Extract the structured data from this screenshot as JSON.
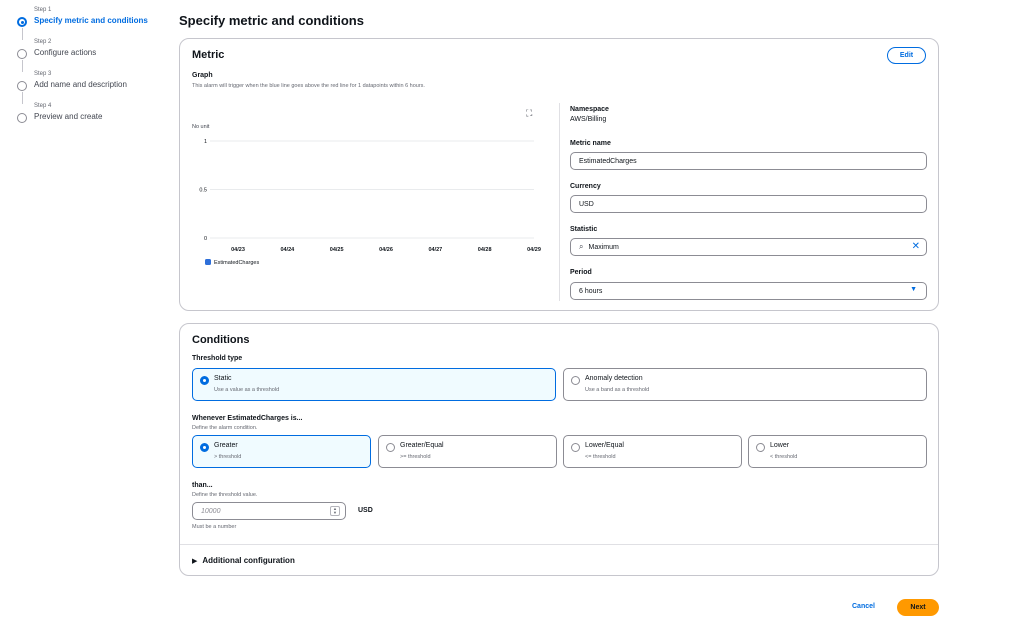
{
  "steps": [
    {
      "step": "Step 1",
      "label": "Specify metric and conditions",
      "active": true
    },
    {
      "step": "Step 2",
      "label": "Configure actions",
      "active": false
    },
    {
      "step": "Step 3",
      "label": "Add name and description",
      "active": false
    },
    {
      "step": "Step 4",
      "label": "Preview and create",
      "active": false
    }
  ],
  "page_title": "Specify metric and conditions",
  "metric": {
    "title": "Metric",
    "edit_label": "Edit",
    "graph_label": "Graph",
    "graph_hint": "This alarm will trigger when the blue line goes above the red line for 1 datapoints within 6 hours.",
    "expand_icon": "expand-icon",
    "namespace_label": "Namespace",
    "namespace_value": "AWS/Billing",
    "metric_name_label": "Metric name",
    "metric_name_value": "EstimatedCharges",
    "currency_label": "Currency",
    "currency_value": "USD",
    "statistic_label": "Statistic",
    "statistic_value": "Maximum",
    "period_label": "Period",
    "period_value": "6 hours"
  },
  "chart_data": {
    "type": "line",
    "ylabel": "No unit",
    "ylim": [
      0,
      1
    ],
    "yticks": [
      "1",
      "0.5",
      "0"
    ],
    "categories": [
      "04/23",
      "04/24",
      "04/25",
      "04/26",
      "04/27",
      "04/28",
      "04/29"
    ],
    "series": [
      {
        "name": "EstimatedCharges",
        "color": "#2e6fd9",
        "values": []
      }
    ]
  },
  "conditions": {
    "title": "Conditions",
    "threshold_type_label": "Threshold type",
    "threshold_types": [
      {
        "title": "Static",
        "sub": "Use a value as a threshold",
        "selected": true
      },
      {
        "title": "Anomaly detection",
        "sub": "Use a band as a threshold",
        "selected": false
      }
    ],
    "whenever_label": "Whenever EstimatedCharges is...",
    "whenever_hint": "Define the alarm condition.",
    "operators": [
      {
        "title": "Greater",
        "sub": "> threshold",
        "selected": true
      },
      {
        "title": "Greater/Equal",
        "sub": ">= threshold",
        "selected": false
      },
      {
        "title": "Lower/Equal",
        "sub": "<= threshold",
        "selected": false
      },
      {
        "title": "Lower",
        "sub": "< threshold",
        "selected": false
      }
    ],
    "than_label": "than...",
    "than_hint": "Define the threshold value.",
    "threshold_placeholder": "10000",
    "threshold_unit": "USD",
    "threshold_note": "Must be a number",
    "additional_config": "Additional configuration"
  },
  "footer": {
    "cancel_label": "Cancel",
    "next_label": "Next"
  },
  "colors": {
    "accent": "#006ce0",
    "primary_button": "#ff9900"
  }
}
